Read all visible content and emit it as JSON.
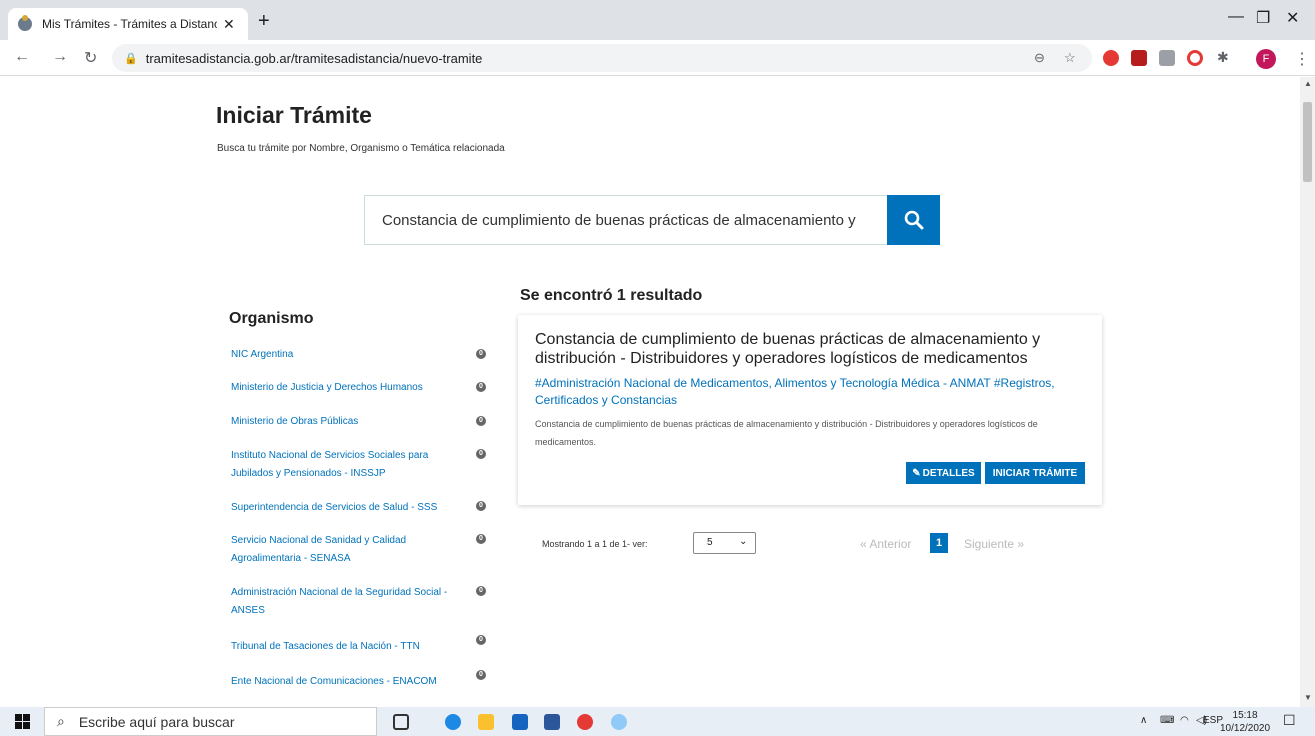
{
  "browser": {
    "tab_title": "Mis Trámites - Trámites a Distanc",
    "url": "tramitesadistancia.gob.ar/tramitesadistancia/nuevo-tramite",
    "profile_initial": "F"
  },
  "page": {
    "title": "Iniciar Trámite",
    "subtitle": "Busca tu trámite por Nombre, Organismo o Temática relacionada",
    "search_value": "Constancia de cumplimiento de buenas prácticas de almacenamiento y"
  },
  "organismos": {
    "title": "Organismo",
    "items": [
      {
        "label": "NIC Argentina",
        "count": "0"
      },
      {
        "label": "Ministerio de Justicia y Derechos Humanos",
        "count": "0"
      },
      {
        "label": "Ministerio de Obras Públicas",
        "count": "0"
      },
      {
        "label": "Instituto Nacional de Servicios Sociales para Jubilados y Pensionados - INSSJP",
        "count": "0"
      },
      {
        "label": "Superintendencia de Servicios de Salud - SSS",
        "count": "0"
      },
      {
        "label": "Servicio Nacional de Sanidad y Calidad Agroalimentaria - SENASA",
        "count": "0"
      },
      {
        "label": "Administración Nacional de la Seguridad Social - ANSES",
        "count": "0"
      },
      {
        "label": "Tribunal de Tasaciones de la Nación - TTN",
        "count": "0"
      },
      {
        "label": "Ente Nacional de Comunicaciones - ENACOM",
        "count": "0"
      }
    ]
  },
  "results": {
    "title": "Se encontró 1 resultado",
    "card": {
      "title": "Constancia de cumplimiento de buenas prácticas de almacenamiento y distribución - Distribuidores y operadores logísticos de medicamentos",
      "tags": "#Administración Nacional de Medicamentos, Alimentos y Tecnología Médica - ANMAT #Registros, Certificados y Constancias",
      "description": "Constancia de cumplimiento de buenas prácticas de almacenamiento y distribución - Distribuidores y operadores logísticos de medicamentos.",
      "details_label": "DETALLES",
      "start_label": "INICIAR TRÁMITE"
    },
    "pagination": {
      "showing": "Mostrando 1 a 1 de 1- ver:",
      "per_page": "5",
      "prev": "« Anterior",
      "current": "1",
      "next": "Siguiente »"
    }
  },
  "taskbar": {
    "search_placeholder": "Escribe aquí para buscar",
    "lang": "ESP",
    "time": "15:18",
    "date": "10/12/2020"
  }
}
